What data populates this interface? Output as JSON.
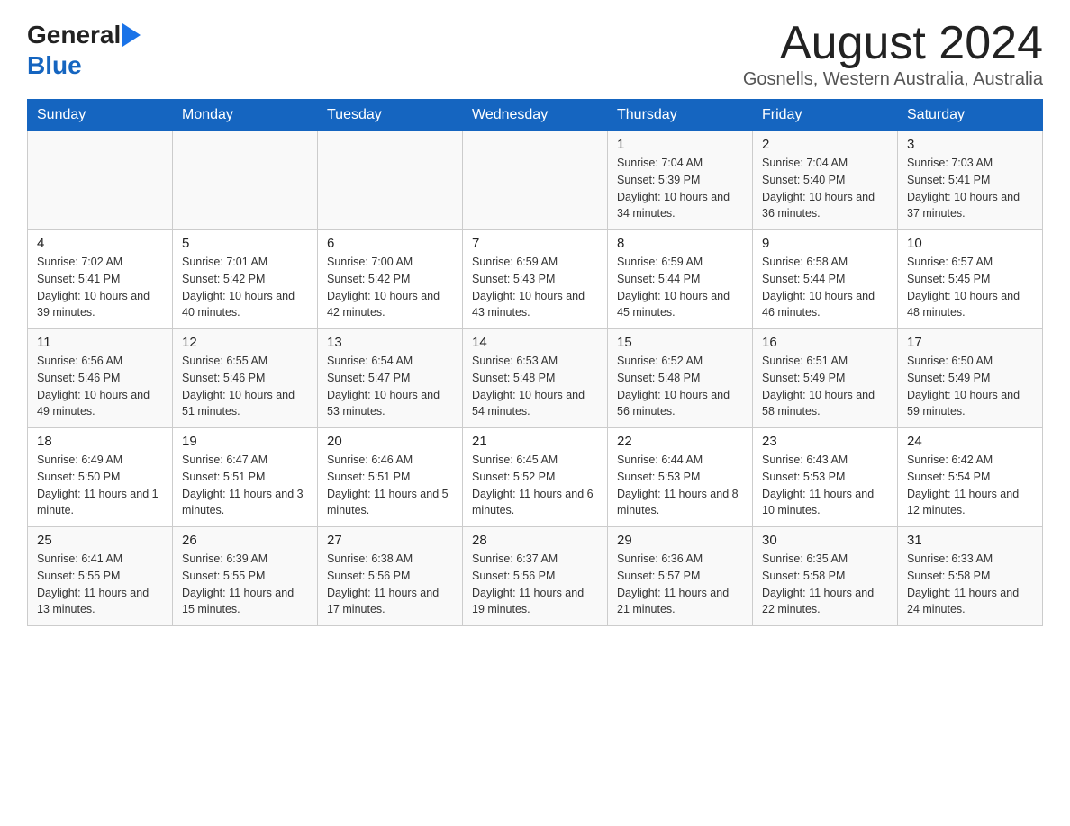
{
  "header": {
    "logo_general": "General",
    "logo_blue": "Blue",
    "title": "August 2024",
    "subtitle": "Gosnells, Western Australia, Australia"
  },
  "calendar": {
    "days_of_week": [
      "Sunday",
      "Monday",
      "Tuesday",
      "Wednesday",
      "Thursday",
      "Friday",
      "Saturday"
    ],
    "weeks": [
      [
        {
          "day": "",
          "sunrise": "",
          "sunset": "",
          "daylight": ""
        },
        {
          "day": "",
          "sunrise": "",
          "sunset": "",
          "daylight": ""
        },
        {
          "day": "",
          "sunrise": "",
          "sunset": "",
          "daylight": ""
        },
        {
          "day": "",
          "sunrise": "",
          "sunset": "",
          "daylight": ""
        },
        {
          "day": "1",
          "sunrise": "Sunrise: 7:04 AM",
          "sunset": "Sunset: 5:39 PM",
          "daylight": "Daylight: 10 hours and 34 minutes."
        },
        {
          "day": "2",
          "sunrise": "Sunrise: 7:04 AM",
          "sunset": "Sunset: 5:40 PM",
          "daylight": "Daylight: 10 hours and 36 minutes."
        },
        {
          "day": "3",
          "sunrise": "Sunrise: 7:03 AM",
          "sunset": "Sunset: 5:41 PM",
          "daylight": "Daylight: 10 hours and 37 minutes."
        }
      ],
      [
        {
          "day": "4",
          "sunrise": "Sunrise: 7:02 AM",
          "sunset": "Sunset: 5:41 PM",
          "daylight": "Daylight: 10 hours and 39 minutes."
        },
        {
          "day": "5",
          "sunrise": "Sunrise: 7:01 AM",
          "sunset": "Sunset: 5:42 PM",
          "daylight": "Daylight: 10 hours and 40 minutes."
        },
        {
          "day": "6",
          "sunrise": "Sunrise: 7:00 AM",
          "sunset": "Sunset: 5:42 PM",
          "daylight": "Daylight: 10 hours and 42 minutes."
        },
        {
          "day": "7",
          "sunrise": "Sunrise: 6:59 AM",
          "sunset": "Sunset: 5:43 PM",
          "daylight": "Daylight: 10 hours and 43 minutes."
        },
        {
          "day": "8",
          "sunrise": "Sunrise: 6:59 AM",
          "sunset": "Sunset: 5:44 PM",
          "daylight": "Daylight: 10 hours and 45 minutes."
        },
        {
          "day": "9",
          "sunrise": "Sunrise: 6:58 AM",
          "sunset": "Sunset: 5:44 PM",
          "daylight": "Daylight: 10 hours and 46 minutes."
        },
        {
          "day": "10",
          "sunrise": "Sunrise: 6:57 AM",
          "sunset": "Sunset: 5:45 PM",
          "daylight": "Daylight: 10 hours and 48 minutes."
        }
      ],
      [
        {
          "day": "11",
          "sunrise": "Sunrise: 6:56 AM",
          "sunset": "Sunset: 5:46 PM",
          "daylight": "Daylight: 10 hours and 49 minutes."
        },
        {
          "day": "12",
          "sunrise": "Sunrise: 6:55 AM",
          "sunset": "Sunset: 5:46 PM",
          "daylight": "Daylight: 10 hours and 51 minutes."
        },
        {
          "day": "13",
          "sunrise": "Sunrise: 6:54 AM",
          "sunset": "Sunset: 5:47 PM",
          "daylight": "Daylight: 10 hours and 53 minutes."
        },
        {
          "day": "14",
          "sunrise": "Sunrise: 6:53 AM",
          "sunset": "Sunset: 5:48 PM",
          "daylight": "Daylight: 10 hours and 54 minutes."
        },
        {
          "day": "15",
          "sunrise": "Sunrise: 6:52 AM",
          "sunset": "Sunset: 5:48 PM",
          "daylight": "Daylight: 10 hours and 56 minutes."
        },
        {
          "day": "16",
          "sunrise": "Sunrise: 6:51 AM",
          "sunset": "Sunset: 5:49 PM",
          "daylight": "Daylight: 10 hours and 58 minutes."
        },
        {
          "day": "17",
          "sunrise": "Sunrise: 6:50 AM",
          "sunset": "Sunset: 5:49 PM",
          "daylight": "Daylight: 10 hours and 59 minutes."
        }
      ],
      [
        {
          "day": "18",
          "sunrise": "Sunrise: 6:49 AM",
          "sunset": "Sunset: 5:50 PM",
          "daylight": "Daylight: 11 hours and 1 minute."
        },
        {
          "day": "19",
          "sunrise": "Sunrise: 6:47 AM",
          "sunset": "Sunset: 5:51 PM",
          "daylight": "Daylight: 11 hours and 3 minutes."
        },
        {
          "day": "20",
          "sunrise": "Sunrise: 6:46 AM",
          "sunset": "Sunset: 5:51 PM",
          "daylight": "Daylight: 11 hours and 5 minutes."
        },
        {
          "day": "21",
          "sunrise": "Sunrise: 6:45 AM",
          "sunset": "Sunset: 5:52 PM",
          "daylight": "Daylight: 11 hours and 6 minutes."
        },
        {
          "day": "22",
          "sunrise": "Sunrise: 6:44 AM",
          "sunset": "Sunset: 5:53 PM",
          "daylight": "Daylight: 11 hours and 8 minutes."
        },
        {
          "day": "23",
          "sunrise": "Sunrise: 6:43 AM",
          "sunset": "Sunset: 5:53 PM",
          "daylight": "Daylight: 11 hours and 10 minutes."
        },
        {
          "day": "24",
          "sunrise": "Sunrise: 6:42 AM",
          "sunset": "Sunset: 5:54 PM",
          "daylight": "Daylight: 11 hours and 12 minutes."
        }
      ],
      [
        {
          "day": "25",
          "sunrise": "Sunrise: 6:41 AM",
          "sunset": "Sunset: 5:55 PM",
          "daylight": "Daylight: 11 hours and 13 minutes."
        },
        {
          "day": "26",
          "sunrise": "Sunrise: 6:39 AM",
          "sunset": "Sunset: 5:55 PM",
          "daylight": "Daylight: 11 hours and 15 minutes."
        },
        {
          "day": "27",
          "sunrise": "Sunrise: 6:38 AM",
          "sunset": "Sunset: 5:56 PM",
          "daylight": "Daylight: 11 hours and 17 minutes."
        },
        {
          "day": "28",
          "sunrise": "Sunrise: 6:37 AM",
          "sunset": "Sunset: 5:56 PM",
          "daylight": "Daylight: 11 hours and 19 minutes."
        },
        {
          "day": "29",
          "sunrise": "Sunrise: 6:36 AM",
          "sunset": "Sunset: 5:57 PM",
          "daylight": "Daylight: 11 hours and 21 minutes."
        },
        {
          "day": "30",
          "sunrise": "Sunrise: 6:35 AM",
          "sunset": "Sunset: 5:58 PM",
          "daylight": "Daylight: 11 hours and 22 minutes."
        },
        {
          "day": "31",
          "sunrise": "Sunrise: 6:33 AM",
          "sunset": "Sunset: 5:58 PM",
          "daylight": "Daylight: 11 hours and 24 minutes."
        }
      ]
    ]
  }
}
